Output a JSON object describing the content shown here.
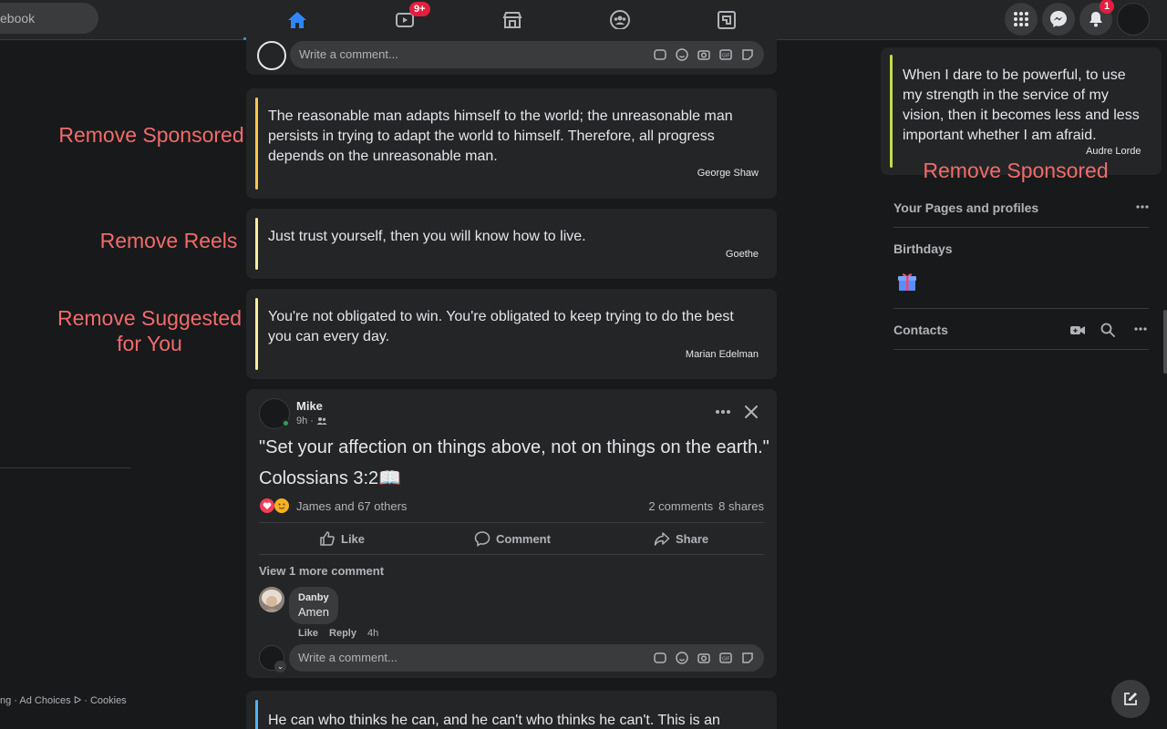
{
  "topbar": {
    "search_text": "ebook",
    "watch_badge": "9+",
    "notifications_badge": "1"
  },
  "feed": {
    "top_comment_placeholder": "Write a comment...",
    "quotes": [
      {
        "text": "The reasonable man adapts himself to the world; the unreasonable man persists in trying to adapt the world to himself. Therefore, all progress depends on the unreasonable man.",
        "author": "George Shaw",
        "bar_color": "#f5c84b"
      },
      {
        "text": "Just trust yourself, then you will know how to live.",
        "author": "Goethe",
        "bar_color": "#f4ef9c"
      },
      {
        "text": "You're not obligated to win. You're obligated to keep trying to do the best you can every day.",
        "author": "Marian Edelman",
        "bar_color": "#f4ef9c"
      }
    ],
    "bottom_quote": {
      "text": "He can who thinks he can, and he can't who thinks he can't. This is an",
      "bar_color": "#4fb4f5"
    },
    "post": {
      "author": "Mike",
      "time": "9h ·",
      "line1": "\"Set your affection on things above, not on things on the earth.\"",
      "line2": "Colossians 3:2📖",
      "reactions": "James and 67 others",
      "comments_count": "2 comments",
      "shares_count": "8 shares",
      "like_label": "Like",
      "comment_label": "Comment",
      "share_label": "Share",
      "view_more": "View 1 more comment",
      "comment": {
        "author": "Danby",
        "text": "Amen",
        "like": "Like",
        "reply": "Reply",
        "time": "4h"
      },
      "comment_placeholder": "Write a comment..."
    }
  },
  "labels": {
    "remove_sponsored": "Remove Sponsored",
    "remove_reels": "Remove Reels",
    "remove_suggested_1": "Remove Suggested",
    "remove_suggested_2": "for You",
    "remove_sponsored_right": "Remove Sponsored"
  },
  "left": {
    "footer": "ng · Ad Choices ᐅ · Cookies"
  },
  "right": {
    "quote_text": "When I dare to be powerful, to use my strength in the service of my vision, then it becomes less and less important whether I am afraid.",
    "quote_author": "Audre Lorde",
    "quote_bar_color": "#c5d94a",
    "pages_heading": "Your Pages and profiles",
    "birthdays_heading": "Birthdays",
    "contacts_heading": "Contacts"
  }
}
